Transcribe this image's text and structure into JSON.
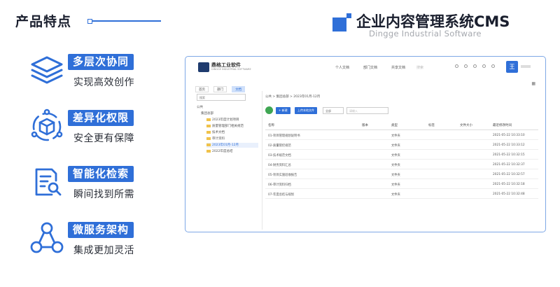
{
  "header": {
    "section_title": "产品特点",
    "brand_title": "企业内容管理系统CMS",
    "brand_subtitle": "Dingge Industrial Software"
  },
  "features": [
    {
      "tag": "多层次协同",
      "desc": "实现高效创作",
      "icon": "layers-icon"
    },
    {
      "tag": "差异化权限",
      "desc": "安全更有保障",
      "icon": "cube-network-icon"
    },
    {
      "tag": "智能化检索",
      "desc": "瞬间找到所需",
      "icon": "document-search-icon"
    },
    {
      "tag": "微服务架构",
      "desc": "集成更加灵活",
      "icon": "nodes-icon"
    }
  ],
  "app": {
    "name": "鼎格工业软件",
    "name_sub": "DINGGE INDUSTRIAL SOFTWARE",
    "top_menu": [
      "个人文档",
      "部门文档",
      "共享文档",
      "搜索"
    ],
    "avatar": "王",
    "tabs": [
      "首页",
      "部门",
      "文档"
    ],
    "sidebar_search": "搜索",
    "tree": [
      "公共",
      "集团总部",
      "2023年度计划项目",
      "质量管理部门相关规范",
      "技术文档",
      "审计资料",
      "2023年01月-12月",
      "2022年度总结"
    ],
    "breadcrumb": "公共 > 集团总部 > 2023年01月-12月",
    "buttons": {
      "new": "+ 新建",
      "upload": "上传本地文件"
    },
    "filter_label": "全部",
    "search_placeholder": "请输入",
    "columns": [
      "名称",
      "版本",
      "类型",
      "标签",
      "文件大小",
      "最近修改时间"
    ],
    "rows": [
      {
        "name": "01-项目管理规划说明书",
        "type": "文件夹",
        "time": "2021-05-22 10:33:10"
      },
      {
        "name": "02-质量管控规范",
        "type": "文件夹",
        "time": "2021-05-22 10:33:12"
      },
      {
        "name": "03-技术规范文档",
        "type": "文件夹",
        "time": "2021-05-22 10:32:15"
      },
      {
        "name": "04-财务资料汇总",
        "type": "文件夹",
        "time": "2021-05-22 10:32:37"
      },
      {
        "name": "05-项目实施验收报告",
        "type": "文件夹",
        "time": "2021-05-22 10:32:57"
      },
      {
        "name": "06-审计资料归档",
        "type": "文件夹",
        "time": "2021-05-22 10:32:18"
      },
      {
        "name": "07-年度总结与规划",
        "type": "文件夹",
        "time": "2021-05-22 10:32:48"
      }
    ]
  },
  "colors": {
    "accent": "#2f6fd8",
    "frame_border": "#7ea8e6",
    "text_dark": "#1a1f2e"
  }
}
